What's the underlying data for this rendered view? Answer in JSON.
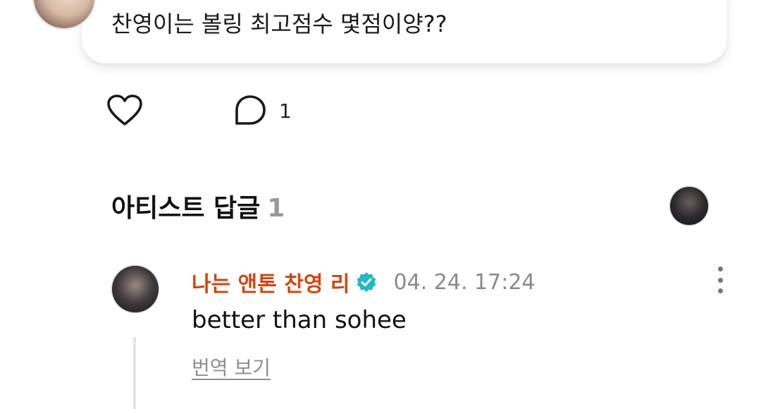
{
  "post": {
    "text": "찬영이는 볼링 최고점수 몇점이양??"
  },
  "actions": {
    "like_icon": "heart-outline-icon",
    "comment_icon": "speech-bubble-icon",
    "comment_count": "1"
  },
  "artist_replies": {
    "title": "아티스트 답글",
    "count": "1"
  },
  "reply": {
    "author": "나는 앤톤 찬영 리",
    "verified_icon": "verified-badge-icon",
    "timestamp": "04. 24. 17:24",
    "text": "better than sohee",
    "translate_label": "번역 보기",
    "more_icon": "more-vertical-icon"
  },
  "colors": {
    "author_name": "#d1460f",
    "verified": "#1fb9c7",
    "muted": "#8a8a8a"
  }
}
